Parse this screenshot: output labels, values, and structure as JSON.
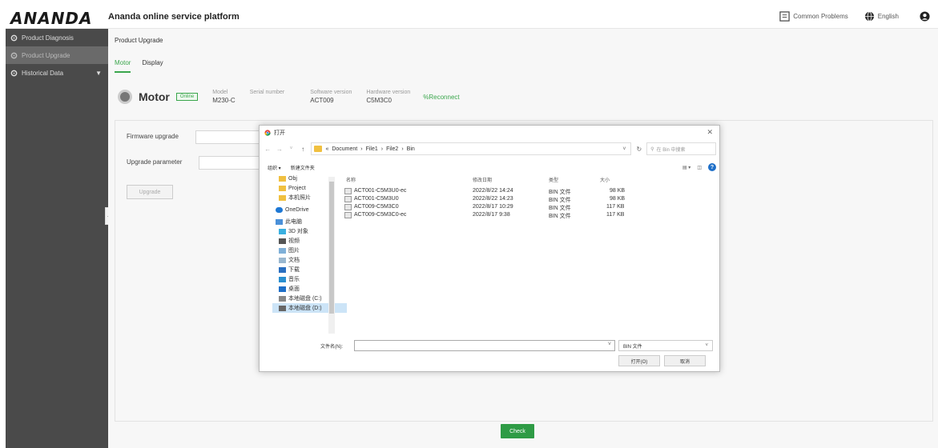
{
  "header": {
    "logo": "ANANDA",
    "title": "Ananda online service platform",
    "common_problems": "Common Problems",
    "language": "English"
  },
  "sidebar": {
    "items": [
      {
        "label": "Product Diagnosis",
        "icon": "gear-icon"
      },
      {
        "label": "Product Upgrade",
        "icon": "gear-icon"
      },
      {
        "label": "Historical Data",
        "icon": "gear-icon"
      }
    ]
  },
  "main": {
    "page_title": "Product Upgrade",
    "tabs": [
      "Motor",
      "Display"
    ],
    "device": {
      "name": "Motor",
      "status": "Online",
      "model_label": "Model",
      "model_value": "M230-C",
      "serial_label": "Serial number",
      "software_label": "Software version",
      "software_value": "ACT009",
      "hardware_label": "Hardware version",
      "hardware_value": "C5M3C0",
      "reconnect": "%Reconnect"
    },
    "form": {
      "firmware_label": "Firmware upgrade",
      "param_label": "Upgrade parameter",
      "upgrade_btn": "Upgrade"
    },
    "check_btn": "Check"
  },
  "dialog": {
    "title": "打开",
    "path": [
      "«",
      "Document",
      "File1",
      "File2",
      "Bin"
    ],
    "search_placeholder": "在 Bin 中搜索",
    "organize": "组织 ▾",
    "new_folder": "新建文件夹",
    "nav_items": [
      {
        "label": "Obj",
        "icon": "folder-icon"
      },
      {
        "label": "Project",
        "icon": "folder-icon"
      },
      {
        "label": "本机照片",
        "icon": "folder-icon"
      },
      {
        "label": "OneDrive",
        "icon": "cloud-icon"
      },
      {
        "label": "此电脑",
        "icon": "computer-icon"
      },
      {
        "label": "3D 对象",
        "icon": "cube-icon"
      },
      {
        "label": "视频",
        "icon": "video-icon"
      },
      {
        "label": "图片",
        "icon": "picture-icon"
      },
      {
        "label": "文档",
        "icon": "document-icon"
      },
      {
        "label": "下载",
        "icon": "download-icon"
      },
      {
        "label": "音乐",
        "icon": "music-icon"
      },
      {
        "label": "桌面",
        "icon": "desktop-icon"
      },
      {
        "label": "本地磁盘 (C:)",
        "icon": "drive-icon"
      },
      {
        "label": "本地磁盘 (D:)",
        "icon": "drive-icon"
      }
    ],
    "columns": [
      "名称",
      "修改日期",
      "类型",
      "大小"
    ],
    "files": [
      {
        "name": "ACT001-C5M3U0-ec",
        "date": "2022/8/22 14:24",
        "type": "BIN 文件",
        "size": "98 KB"
      },
      {
        "name": "ACT001-C5M3U0",
        "date": "2022/8/22 14:23",
        "type": "BIN 文件",
        "size": "98 KB"
      },
      {
        "name": "ACT009-C5M3C0",
        "date": "2022/8/17 10:29",
        "type": "BIN 文件",
        "size": "117 KB"
      },
      {
        "name": "ACT009-C5M3C0-ec",
        "date": "2022/8/17 9:38",
        "type": "BIN 文件",
        "size": "117 KB"
      }
    ],
    "filename_label": "文件名(N):",
    "filetype": "BIN 文件",
    "open_btn": "打开(O)",
    "cancel_btn": "取消"
  }
}
